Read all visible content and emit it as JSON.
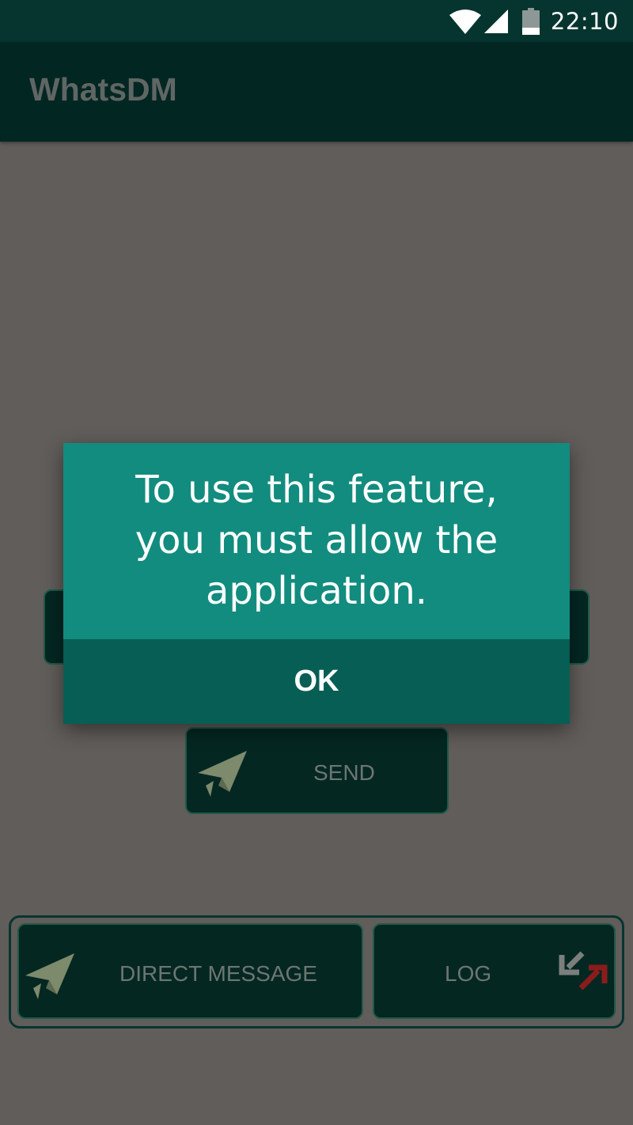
{
  "status_bar": {
    "time": "22:10",
    "icons": [
      "wifi-icon",
      "cell-signal-icon",
      "battery-icon"
    ]
  },
  "app_bar": {
    "title": "WhatsDM"
  },
  "main": {
    "send_button_label": "SEND",
    "send_icon": "paper-plane-icon"
  },
  "bottom_nav": {
    "direct_message_label": "DIRECT MESSAGE",
    "direct_message_icon": "paper-plane-icon",
    "log_label": "LOG",
    "log_icon": "in-out-arrows-icon"
  },
  "dialog": {
    "message": "To use this feature, you must allow the application.",
    "ok_label": "OK"
  },
  "colors": {
    "status_bar": "#063530",
    "app_bar": "#022722",
    "scrim_background": "#615d5a",
    "dialog_body": "#128c7e",
    "dialog_button": "#075e54",
    "log_out_arrow": "#9b1d1d"
  }
}
